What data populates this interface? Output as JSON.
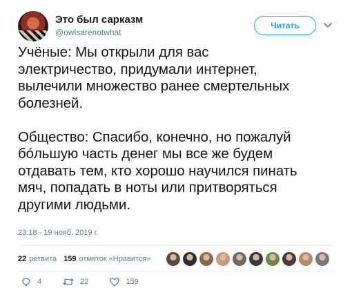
{
  "author": {
    "name": "Это был сарказм",
    "handle": "@owlsarenotwhat"
  },
  "follow_label": "Читать",
  "tweet": {
    "text": "Учёные: Мы открыли для вас\nэлектричество, придумали интернет,\nвылечили множество ранее смертельных\nболезней.\n\nОбщество: Спасибо, конечно, но пожалуй\nбо́льшую часть денег мы все же будем\nотдавать тем, кто хорошо научился пинать\nмяч, попадать в ноты или притворяться\nдругими людьми.",
    "timestamp": "23:18 - 19 нояб. 2019 г."
  },
  "stats": {
    "retweets_count": "22",
    "retweets_label": "ретвита",
    "likes_count": "159",
    "likes_label": "отметок «Нравится»"
  },
  "liker_avatar_colors": [
    "#5a4a42",
    "#2f2f2f",
    "#8a6a4a",
    "#c69a7a",
    "#6b6b6b",
    "#3a3a3a",
    "#6f8a4a",
    "#4a3a3a",
    "#b58a6a",
    "#7a7a7a"
  ],
  "actions": {
    "replies": "4",
    "retweets": "22",
    "likes": "159"
  },
  "icons": [
    "chevron-down-icon",
    "reply-icon",
    "retweet-icon",
    "heart-icon"
  ],
  "colors": {
    "accent": "#1da1f2",
    "muted": "#657786",
    "text": "#14171a",
    "divider": "#e6ecf0"
  }
}
